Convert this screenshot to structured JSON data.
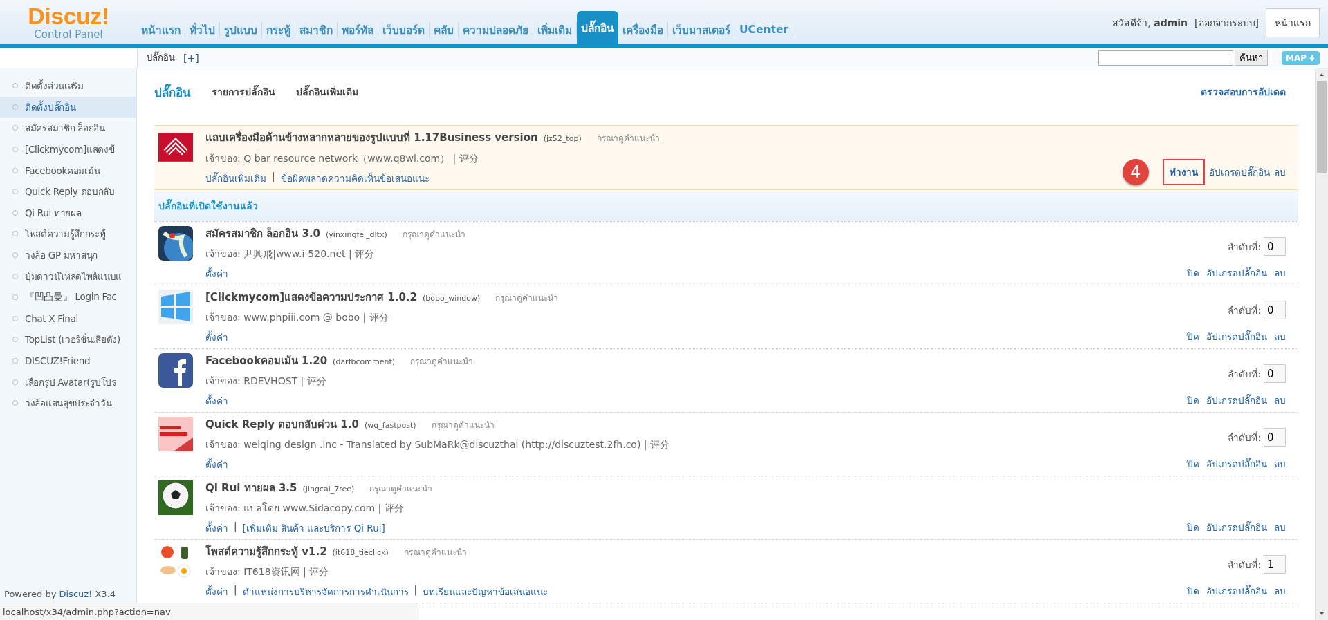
{
  "logo": {
    "title": "Discuz!",
    "subtitle": "Control Panel"
  },
  "nav_tabs": [
    {
      "label": "หน้าแรก",
      "selected": false
    },
    {
      "label": "ทั่วไป",
      "selected": false
    },
    {
      "label": "รูปแบบ",
      "selected": false
    },
    {
      "label": "กระทู้",
      "selected": false
    },
    {
      "label": "สมาชิก",
      "selected": false
    },
    {
      "label": "พอร์ทัล",
      "selected": false
    },
    {
      "label": "เว็บบอร์ด",
      "selected": false
    },
    {
      "label": "คลับ",
      "selected": false
    },
    {
      "label": "ความปลอดภัย",
      "selected": false
    },
    {
      "label": "เพิ่มเติม",
      "selected": false
    },
    {
      "label": "ปลั๊กอิน",
      "selected": true
    },
    {
      "label": "เครื่องมือ",
      "selected": false
    },
    {
      "label": "เว็บมาสเตอร์",
      "selected": false
    },
    {
      "label": "UCenter",
      "selected": false
    }
  ],
  "user": {
    "greeting": "สวัสดีจ้า,",
    "name": "admin",
    "logout": "[ออกจากระบบ]",
    "home_button": "หน้าแรก"
  },
  "subbar": {
    "title": "ปลั๊กอิน",
    "add": "[+]",
    "search_button": "ค้นหา",
    "map_button": "MAP"
  },
  "sidebar": {
    "items": [
      {
        "label": "ติดตั้งส่วนเสริม",
        "selected": false
      },
      {
        "label": "ติดตั้งปลั๊กอิน",
        "selected": true
      },
      {
        "label": "สมัครสมาชิก ล็อกอิน",
        "selected": false
      },
      {
        "label": "[Clickmycom]แสดงข้",
        "selected": false
      },
      {
        "label": "Facebookคอมเม้น",
        "selected": false
      },
      {
        "label": "Quick Reply ตอบกลับ",
        "selected": false
      },
      {
        "label": "Qi Rui ทายผล",
        "selected": false
      },
      {
        "label": "โพสต์ความรู้สึกกระทู้",
        "selected": false
      },
      {
        "label": "วงล้อ GP มหาสนุก",
        "selected": false
      },
      {
        "label": "ปุ่มดาวน์โหลดไพล์แนบแ",
        "selected": false
      },
      {
        "label": "『凹凸曼』 Login Fac",
        "selected": false
      },
      {
        "label": "Chat X Final",
        "selected": false
      },
      {
        "label": "TopList (เวอร์ชั่นเสียดัง)",
        "selected": false
      },
      {
        "label": "DISCUZ!Friend",
        "selected": false
      },
      {
        "label": "เลือกรูป Avatar(รูปโปร",
        "selected": false
      },
      {
        "label": "วงล้อแสนสุขประจำวัน",
        "selected": false
      }
    ]
  },
  "page": {
    "title": "ปลั๊กอิน",
    "tabs": [
      "รายการปลั๊กอิน",
      "ปลั๊กอินเพิ่มเติม"
    ],
    "check_updates": "ตรวจสอบการอัปเดต"
  },
  "pending_plugin": {
    "kind": "chevrons",
    "name": "แถบเครื่องมือด้านข้างหลากหลายของรูปแบบที่ 1.17Business version",
    "id": "(jz52_top)",
    "hint": "กรุณาดูคำแนะนำ",
    "owner": "เจ้าของ: Q bar resource network（www.q8wl.com） | 评分",
    "links": [
      {
        "kind": "link",
        "text": "ปลั๊กอินเพิ่มเติม"
      },
      {
        "kind": "separator",
        "text": "|"
      },
      {
        "kind": "link",
        "text": "ข้อผิดพลาดความคิดเห็นข้อเสนอแนะ"
      }
    ],
    "step_badge": "4",
    "actions": [
      {
        "label": "ทำงาน",
        "highlighted": true
      },
      {
        "label": "อัปเกรดปลั๊กอิน",
        "highlighted": false
      },
      {
        "label": "ลบ",
        "highlighted": false
      }
    ]
  },
  "section_title": "ปลั๊กอินที่เปิดใช้งานแล้ว",
  "plugins": [
    {
      "kind": "globe",
      "name": "สมัครสมาชิก ล็อกอิน 3.0",
      "id": "(yinxingfei_dltx)",
      "hint": "กรุณาดูคำแนะนำ",
      "owner": "เจ้าของ: 尹興飛|www.i-520.net | 评分",
      "links": [
        {
          "kind": "link",
          "text": "ตั้งค่า"
        }
      ],
      "order_label": "ลำดับที่:",
      "order": "0",
      "actions": [
        "ปิด",
        "อัปเกรดปลั๊กอิน",
        "ลบ"
      ]
    },
    {
      "kind": "windows",
      "name": "[Clickmycom]แสดงข้อความประกาศ 1.0.2",
      "id": "(bobo_window)",
      "hint": "กรุณาดูคำแนะนำ",
      "owner": "เจ้าของ: www.phpiii.com @ bobo | 评分",
      "links": [
        {
          "kind": "link",
          "text": "ตั้งค่า"
        }
      ],
      "order_label": "ลำดับที่:",
      "order": "0",
      "actions": [
        "ปิด",
        "อัปเกรดปลั๊กอิน",
        "ลบ"
      ]
    },
    {
      "kind": "facebook",
      "name": "Facebookคอมเม้น 1.20",
      "id": "(darfbcomment)",
      "hint": "กรุณาดูคำแนะนำ",
      "owner": "เจ้าของ: RDEVHOST | 评分",
      "links": [
        {
          "kind": "link",
          "text": "ตั้งค่า"
        }
      ],
      "order_label": "ลำดับที่:",
      "order": "0",
      "actions": [
        "ปิด",
        "อัปเกรดปลั๊กอิน",
        "ลบ"
      ]
    },
    {
      "kind": "fast",
      "name": "Quick Reply ตอบกลับด่วน 1.0",
      "id": "(wq_fastpost)",
      "hint": "กรุณาดูคำแนะนำ",
      "owner": "เจ้าของ: weiqing design .inc - Translated by SubMaRk@discuzthai (http://discuztest.2fh.co) | 评分",
      "links": [
        {
          "kind": "link",
          "text": "ตั้งค่า"
        }
      ],
      "order_label": "ลำดับที่:",
      "order": "0",
      "actions": [
        "ปิด",
        "อัปเกรดปลั๊กอิน",
        "ลบ"
      ]
    },
    {
      "kind": "football",
      "name": "Qi Rui ทายผล 3.5",
      "id": "(jingcai_7ree)",
      "hint": "กรุณาดูคำแนะนำ",
      "owner": "เจ้าของ: แปลโดย www.Sidacopy.com | 评分",
      "links": [
        {
          "kind": "link",
          "text": "ตั้งค่า"
        },
        {
          "kind": "separator",
          "text": "|"
        },
        {
          "kind": "link",
          "text": "[เพิ่มเติม สินค้า และบริการ Qi Rui]"
        }
      ],
      "actions": [
        "ปิด",
        "อัปเกรดปลั๊กอิน",
        "ลบ"
      ]
    },
    {
      "kind": "emoji",
      "name": "โพสต์ความรู้สึกกระทู้ v1.2",
      "id": "(it618_tieclick)",
      "hint": "กรุณาดูคำแนะนำ",
      "owner": "เจ้าของ: IT618资讯网 | 评分",
      "links": [
        {
          "kind": "link",
          "text": "ตั้งค่า"
        },
        {
          "kind": "separator",
          "text": "|"
        },
        {
          "kind": "link",
          "text": "ตำแหน่งการบริหารจัดการการดำเนินการ"
        },
        {
          "kind": "separator",
          "text": "|"
        },
        {
          "kind": "link",
          "text": "บทเรียนและปัญหาข้อเสนอแนะ"
        }
      ],
      "order_label": "ลำดับที่:",
      "order": "1",
      "actions": [
        "ปิด",
        "อัปเกรดปลั๊กอิน",
        "ลบ"
      ]
    }
  ],
  "footer": {
    "powered": "Powered by",
    "brand": "Discuz!",
    "version": "X3.4"
  },
  "status_bar": "localhost/x34/admin.php?action=nav"
}
